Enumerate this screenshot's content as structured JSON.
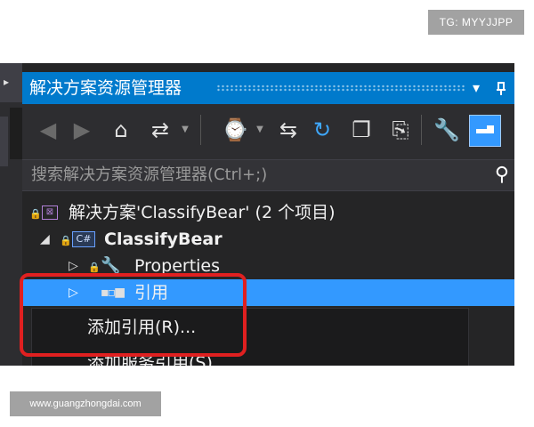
{
  "watermarks": {
    "top": "TG: MYYJJPP",
    "bottom": "www.guangzhongdai.com"
  },
  "panel": {
    "title": "解决方案资源管理器",
    "title_buttons": [
      "▾",
      "🖈",
      "✕"
    ]
  },
  "toolbar": {
    "icons": [
      "back-icon",
      "forward-icon",
      "home-icon",
      "sync-icon",
      "dropdown-icon",
      "history-icon",
      "dropdown-icon",
      "switch-view-icon",
      "refresh-icon",
      "collapse-all-icon",
      "show-all-files-icon",
      "properties-wrench-icon",
      "preview-icon"
    ]
  },
  "search": {
    "placeholder": "搜索解决方案资源管理器(Ctrl+;)"
  },
  "tree": {
    "solution": {
      "label": "解决方案'ClassifyBear' (2 个项目)",
      "icon_text": "⊠"
    },
    "project": {
      "label": "ClassifyBear",
      "icon_text": "C#"
    },
    "properties": {
      "label": "Properties"
    },
    "references": {
      "label": "引用"
    }
  },
  "context_menu": {
    "items": [
      "添加引用(R)...",
      "添加服务引用(S)..."
    ]
  },
  "colors": {
    "accent": "#007acc",
    "selection": "#3399ff",
    "highlight_box": "#e02020"
  }
}
